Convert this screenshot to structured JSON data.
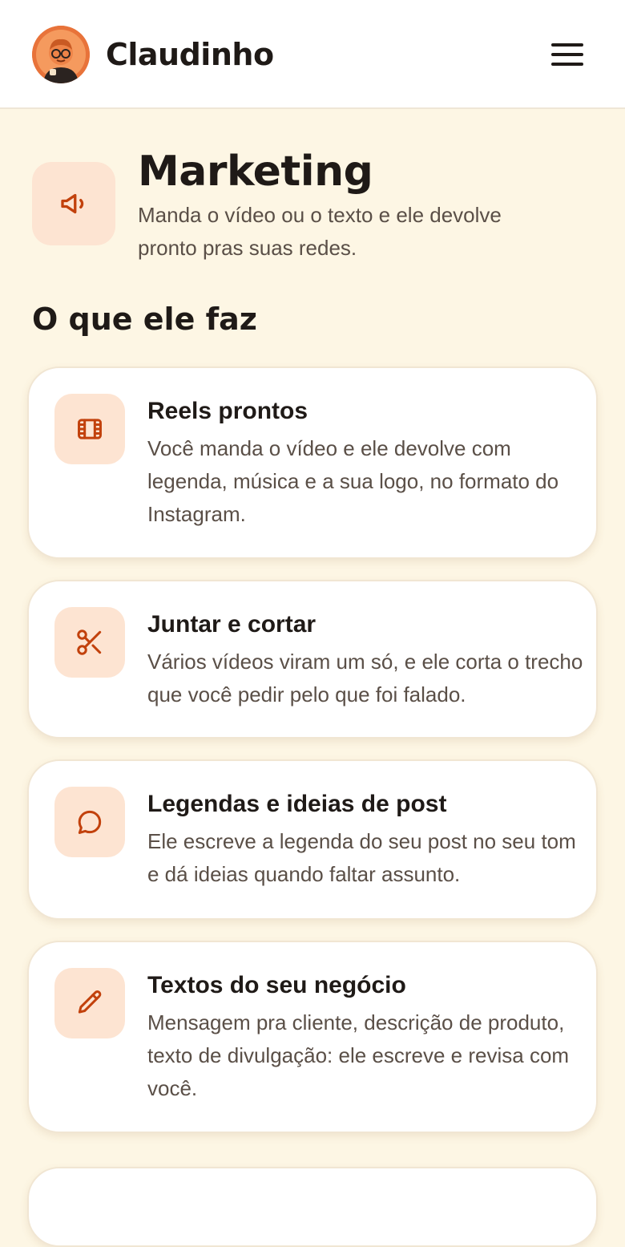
{
  "header": {
    "brand": "Claudinho",
    "menu_icon": "hamburger-menu-icon",
    "avatar_icon": "claudinho-avatar"
  },
  "hero": {
    "icon": "megaphone-icon",
    "title": "Marketing",
    "description": "Manda o vídeo ou o texto e ele devolve pronto pras suas redes."
  },
  "section": {
    "title": "O que ele faz"
  },
  "features": [
    {
      "icon": "film-icon",
      "title": "Reels prontos",
      "description": "Você manda o vídeo e ele devolve com legenda, música e a sua logo, no formato do Instagram."
    },
    {
      "icon": "scissors-icon",
      "title": "Juntar e cortar",
      "description": "Vários vídeos viram um só, e ele corta o trecho que você pedir pelo que foi falado."
    },
    {
      "icon": "chat-bubble-icon",
      "title": "Legendas e ideias de post",
      "description": "Ele escreve a legenda do seu post no seu tom e dá ideias quando faltar assunto."
    },
    {
      "icon": "pencil-icon",
      "title": "Textos do seu negócio",
      "description": "Mensagem pra cliente, descrição de produto, texto de divulgação: ele escreve e revisa com você."
    }
  ],
  "colors": {
    "page_background": "#fdf6e4",
    "accent": "#c2410c",
    "icon_tile": "#fde4d2",
    "card_background": "#ffffff",
    "text_primary": "#1f1a17",
    "text_secondary": "#5a4f47"
  }
}
